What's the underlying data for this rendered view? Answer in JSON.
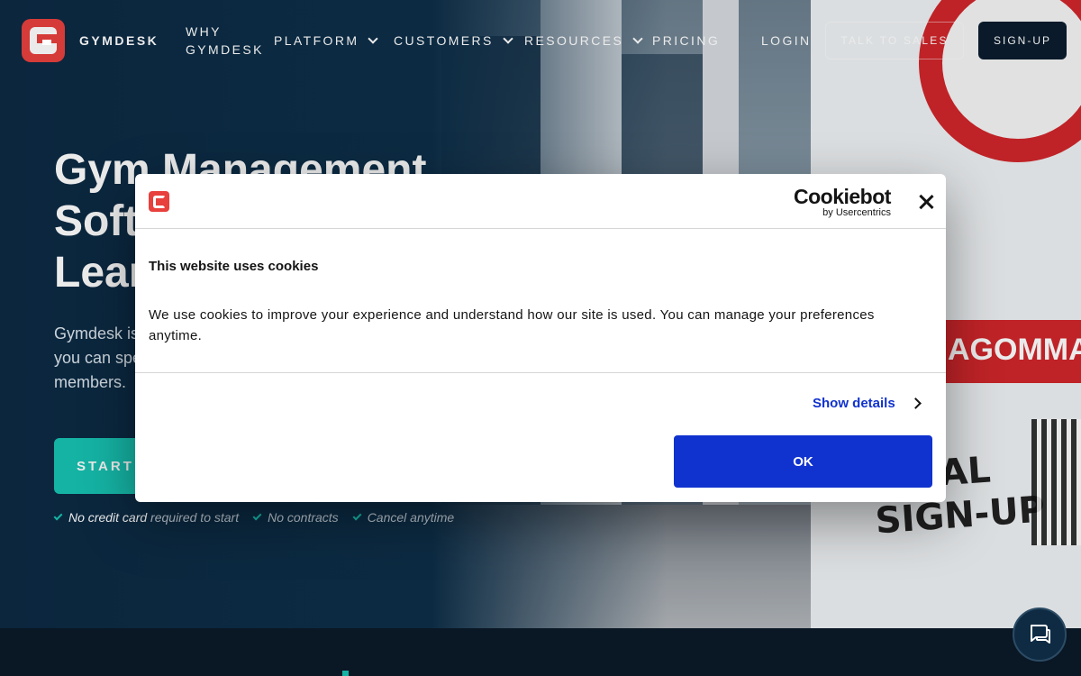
{
  "nav": {
    "brand": "GYMDESK",
    "why_line1": "WHY",
    "why_line2": "GYMDESK",
    "platform": "PLATFORM",
    "customers": "CUSTOMERS",
    "resources": "RESOURCES",
    "pricing": "PRICING",
    "login": "LOGIN",
    "talk_to_sales": "TALK TO SALES",
    "sign_up": "SIGN-UP"
  },
  "hero": {
    "title_line1": "Gym Management",
    "title_line2": "Soft",
    "title_line3": "Lear",
    "sub_line1": "Gymdesk is",
    "sub_line2": "you can spe",
    "sub_line3": "members.",
    "cta": "START Y",
    "checks": [
      {
        "strong": "No credit card",
        "rest": " required to start"
      },
      {
        "strong": "",
        "rest": "No contracts"
      },
      {
        "strong": "",
        "rest": "Cancel anytime"
      }
    ]
  },
  "photo": {
    "banner": "AGOMMA",
    "sign_line1": "IAL",
    "sign_line2": "SIGN-UP"
  },
  "cookie_dialog": {
    "provider_name": "Cookiebot",
    "provider_by": "by Usercentrics",
    "title": "This website uses cookies",
    "body": "We use cookies to improve your experience and understand how our site is used. You can manage your preferences anytime.",
    "show_details": "Show details",
    "ok": "OK"
  },
  "colors": {
    "brand_red": "#e8403d",
    "teal": "#17c3b2",
    "cookie_blue": "#1032cf",
    "navy": "#0d2437"
  }
}
